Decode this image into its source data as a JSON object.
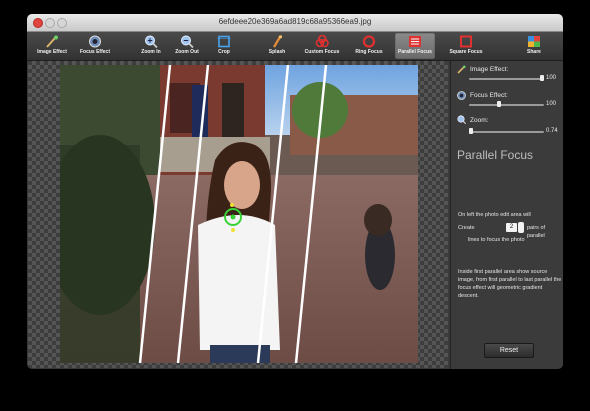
{
  "window": {
    "title": "6efdeee20e369a6ad819c68a95366ea9.jpg"
  },
  "toolbar": {
    "image_effect": "Image Effect",
    "focus_effect": "Focus Effect",
    "zoom_in": "Zoom In",
    "zoom_out": "Zoom Out",
    "crop": "Crop",
    "splash": "Splash",
    "custom_focus": "Custom Focus",
    "ring_focus": "Ring Focus",
    "parallel_focus": "Parallel Focus",
    "square_focus": "Square Focus",
    "share": "Share"
  },
  "panel": {
    "image_effect_label": "Image Effect:",
    "image_effect_value": "100",
    "focus_effect_label": "Focus Effect:",
    "focus_effect_value": "100",
    "zoom_label": "Zoom:",
    "zoom_value": "0.74",
    "mode_title": "Parallel Focus",
    "desc1": "On left the photo edit area will",
    "create_label": "Create",
    "pairs_value": "2",
    "pairs_label": "pairs of parallel",
    "desc2": "lines to focus the photo",
    "desc3": "Inside first parallel area show source image, from first parallel to last parallel the focus effect will geometric gradient descent.",
    "reset": "Reset"
  },
  "colors": {
    "accent_red": "#e0443e",
    "focus_green": "#39d339",
    "active_tool": "#7a7a7a"
  }
}
